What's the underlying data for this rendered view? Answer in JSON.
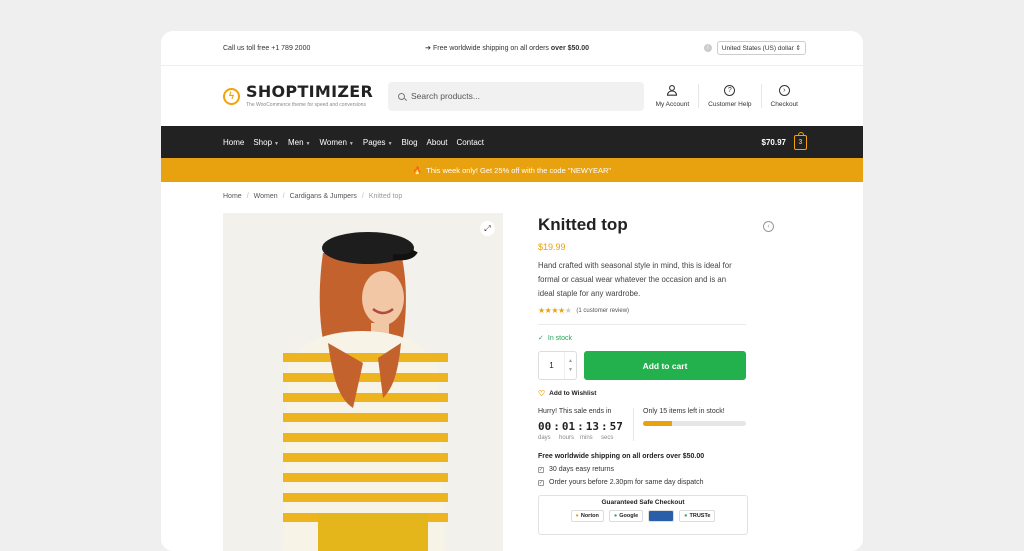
{
  "topbar": {
    "phone": "Call us toll free +1 789 2000",
    "shipping_prefix": "Free worldwide shipping on all orders",
    "shipping_bold": "over $50.00",
    "currency": "United States (US) dollar"
  },
  "header": {
    "logo": "SHOPTIMIZER",
    "tagline": "The WooCommerce theme for speed and conversions",
    "search_placeholder": "Search products...",
    "icons": [
      {
        "label": "My Account",
        "icon": "user-icon"
      },
      {
        "label": "Customer Help",
        "icon": "help-icon"
      },
      {
        "label": "Checkout",
        "icon": "arrow-right-icon"
      }
    ]
  },
  "nav": {
    "items": [
      {
        "label": "Home",
        "dropdown": false
      },
      {
        "label": "Shop",
        "dropdown": true
      },
      {
        "label": "Men",
        "dropdown": true
      },
      {
        "label": "Women",
        "dropdown": true
      },
      {
        "label": "Pages",
        "dropdown": true
      },
      {
        "label": "Blog",
        "dropdown": false
      },
      {
        "label": "About",
        "dropdown": false
      },
      {
        "label": "Contact",
        "dropdown": false
      }
    ],
    "cart_total": "$70.97",
    "cart_count": "3"
  },
  "promo": "This week only! Get 25% off with the code \"NEWYEAR\"",
  "breadcrumb": [
    "Home",
    "Women",
    "Cardigans & Jumpers",
    "Knitted top"
  ],
  "product": {
    "title": "Knitted top",
    "price": "$19.99",
    "description": "Hand crafted with seasonal style in mind, this is ideal for formal or casual wear whatever the occasion and is an ideal staple for any wardrobe.",
    "rating": 4,
    "review_text": "(1 customer review)",
    "stock": "In stock",
    "quantity": "1",
    "add_to_cart": "Add to cart",
    "wishlist": "Add to Wishlist",
    "sale_label": "Hurry! This sale ends in",
    "timer": {
      "days": "00",
      "hours": "01",
      "mins": "13",
      "secs": "57"
    },
    "timer_units": {
      "days": "days",
      "hours": "hours",
      "mins": "mins",
      "secs": "secs"
    },
    "stock_left": "Only 15 items left in stock!",
    "stock_bar_fraction": 0.28,
    "free_shipping": "Free worldwide shipping on all orders over $50.00",
    "perks": [
      "30 days easy returns",
      "Order yours before 2.30pm for same day dispatch"
    ],
    "safe_checkout": "Guaranteed Safe Checkout",
    "badges": [
      "Norton",
      "Google",
      "",
      "TRUSTe"
    ]
  },
  "colors": {
    "accent": "#e8a10f",
    "cart_button": "#23b14d",
    "nav_bg": "#222222",
    "stock_green": "#23a455"
  }
}
